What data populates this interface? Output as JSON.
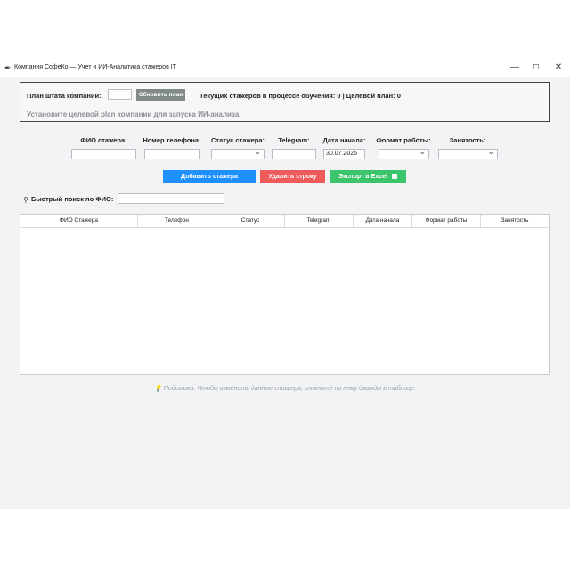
{
  "window": {
    "title": "Компания СофеКо — Учет и ИИ-Аналитика стажеров IT",
    "icon": "feather-icon",
    "controls": {
      "minimize": "—",
      "maximize": "☐",
      "close": "✕"
    }
  },
  "plan": {
    "label": "План штата компании:",
    "input_value": "",
    "update_button": "Обновить план",
    "status": "Текущих стажеров в процессе обучения: 0 | Целевой план: 0",
    "hint": "Установите целевой plan компании для запуска ИИ-анализа."
  },
  "form": {
    "fio_label": "ФИО стажера:",
    "phone_label": "Номер телефона:",
    "status_label": "Статус стажера:",
    "telegram_label": "Telegram:",
    "date_label": "Дата начала:",
    "format_label": "Формат работы:",
    "employment_label": "Занятость:",
    "date_value": "30.07.2026"
  },
  "actions": {
    "add": "Добавить стажера",
    "delete": "Удалить строку",
    "export": "Экспорт в Excel",
    "colors": {
      "add": "#1e90ff",
      "delete": "#ef5b5b",
      "export": "#3cc46a"
    }
  },
  "search": {
    "label": "Быстрый поиск по ФИО:",
    "value": ""
  },
  "table": {
    "columns": [
      "ФИО Стажера",
      "Телефон",
      "Статус",
      "Telegram",
      "Дата начала",
      "Формат работы",
      "Занятость"
    ],
    "rows": []
  },
  "tip": "Подсказка: Чтобы изменить данные стажера, кликните по нему дважды в таблице."
}
